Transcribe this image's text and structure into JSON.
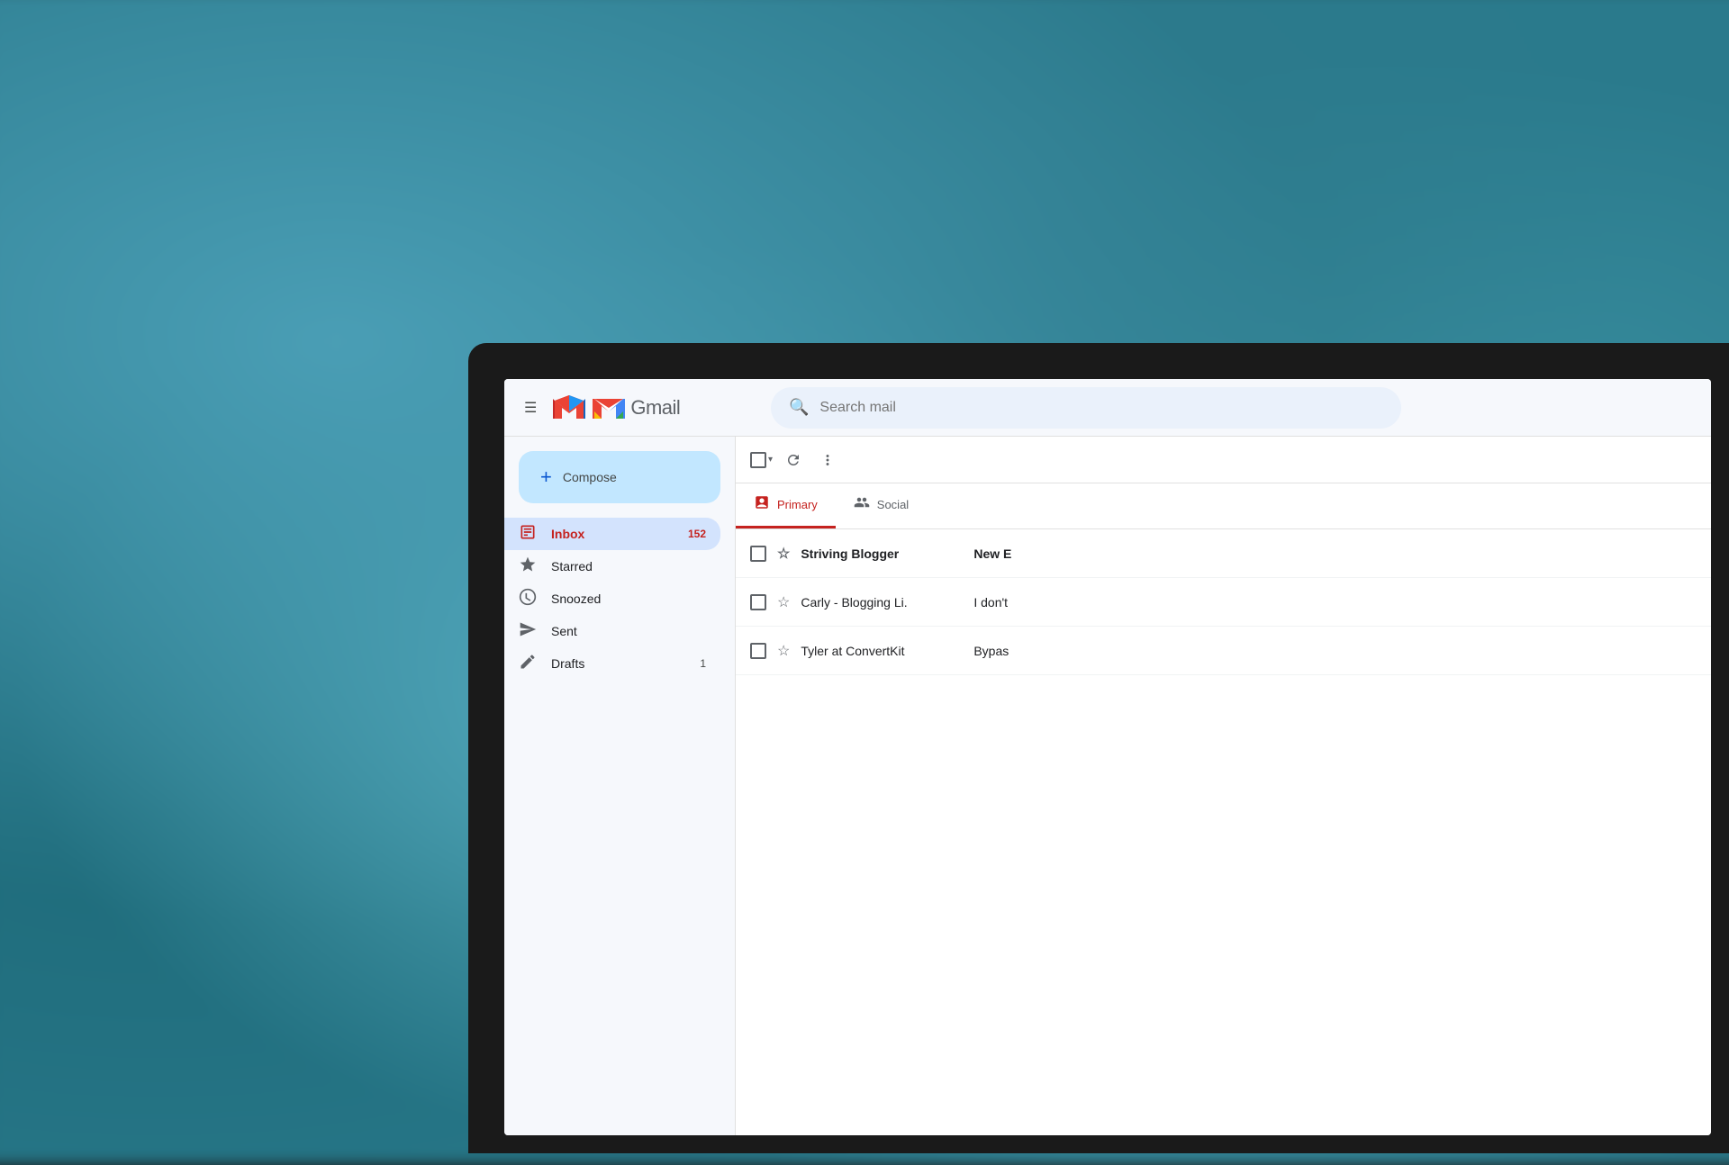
{
  "background": {
    "color": "#2a7a8c"
  },
  "gmail": {
    "title": "Gmail",
    "search_placeholder": "Search mail",
    "logo_alt": "Gmail"
  },
  "header": {
    "hamburger_label": "☰",
    "search_icon": "🔍"
  },
  "compose": {
    "plus_icon": "+",
    "label": "Compose"
  },
  "nav": {
    "items": [
      {
        "id": "inbox",
        "icon": "inbox",
        "label": "Inbox",
        "count": "152",
        "active": true
      },
      {
        "id": "starred",
        "icon": "star",
        "label": "Starred",
        "count": "",
        "active": false
      },
      {
        "id": "snoozed",
        "icon": "snoozed",
        "label": "Snoozed",
        "count": "",
        "active": false
      },
      {
        "id": "sent",
        "icon": "sent",
        "label": "Sent",
        "count": "",
        "active": false
      },
      {
        "id": "drafts",
        "icon": "drafts",
        "label": "Drafts",
        "count": "1",
        "active": false
      }
    ]
  },
  "toolbar": {
    "select_all_label": "Select all",
    "refresh_label": "Refresh",
    "more_label": "More"
  },
  "tabs": [
    {
      "id": "primary",
      "icon": "inbox-tab",
      "label": "Primary",
      "active": true
    },
    {
      "id": "social",
      "icon": "people",
      "label": "Social",
      "active": false
    }
  ],
  "emails": [
    {
      "id": 1,
      "sender": "Striving Blogger",
      "subject": "New E",
      "preview": "New E",
      "unread": true,
      "starred": false
    },
    {
      "id": 2,
      "sender": "Carly - Blogging Li.",
      "subject": "I don't",
      "preview": "I don't",
      "unread": false,
      "starred": false
    },
    {
      "id": 3,
      "sender": "Tyler at ConvertKit",
      "subject": "Bypas",
      "preview": "Bypas",
      "unread": false,
      "starred": false
    }
  ]
}
